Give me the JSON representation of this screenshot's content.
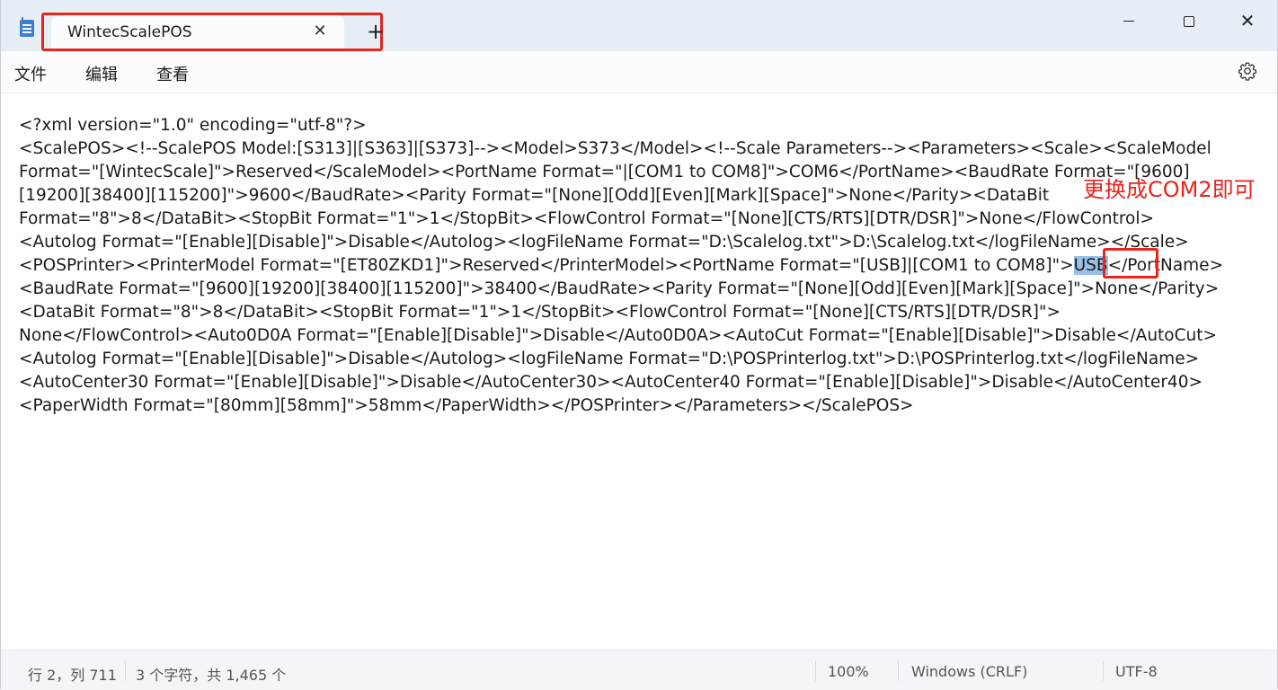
{
  "tab": {
    "title": "WintecScalePOS",
    "close_glyph": "✕",
    "new_tab_glyph": "+"
  },
  "window_controls": {
    "close_glyph": "✕"
  },
  "menu": {
    "file": "文件",
    "edit": "编辑",
    "view": "查看"
  },
  "editor": {
    "lines": [
      "<?xml version=\"1.0\" encoding=\"utf-8\"?>",
      "<ScalePOS><!--ScalePOS Model:[S313]|[S363]|[S373]--><Model>S373</Model><!--Scale Parameters--><Parameters><Scale><ScaleModel",
      "Format=\"[WintecScale]\">Reserved</ScaleModel><PortName Format=\"|[COM1 to COM8]\">COM6</PortName><BaudRate Format=\"[9600]",
      "[19200][38400][115200]\">9600</BaudRate><Parity Format=\"[None][Odd][Even][Mark][Space]\">None</Parity><DataBit",
      "Format=\"8\">8</DataBit><StopBit Format=\"1\">1</StopBit><FlowControl Format=\"[None][CTS/RTS][DTR/DSR]\">None</FlowControl>",
      "<Autolog Format=\"[Enable][Disable]\">Disable</Autolog><logFileName Format=\"D:\\Scalelog.txt\">D:\\Scalelog.txt</logFileName></Scale>",
      "<POSPrinter><PrinterModel Format=\"[ET80ZKD1]\">Reserved</PrinterModel><PortName Format=\"[USB]|[COM1 to COM8]\">",
      "<BaudRate Format=\"[9600][19200][38400][115200]\">38400</BaudRate><Parity Format=\"[None][Odd][Even][Mark][Space]\">None</Parity>",
      "<DataBit Format=\"8\">8</DataBit><StopBit Format=\"1\">1</StopBit><FlowControl Format=\"[None][CTS/RTS][DTR/DSR]\">",
      "None</FlowControl><Auto0D0A Format=\"[Enable][Disable]\">Disable</Auto0D0A><AutoCut Format=\"[Enable][Disable]\">Disable</AutoCut>",
      "<Autolog Format=\"[Enable][Disable]\">Disable</Autolog><logFileName Format=\"D:\\POSPrinterlog.txt\">D:\\POSPrinterlog.txt</logFileName>",
      "<AutoCenter30 Format=\"[Enable][Disable]\">Disable</AutoCenter30><AutoCenter40 Format=\"[Enable][Disable]\">Disable</AutoCenter40>",
      "<PaperWidth Format=\"[80mm][58mm]\">58mm</PaperWidth></POSPrinter></Parameters></ScalePOS>"
    ],
    "selected_text": "USB",
    "line7_tail": "</PortName>"
  },
  "annotation": {
    "text": "更换成COM2即可",
    "color": "#e8241d"
  },
  "status": {
    "position": "行 2，列 711",
    "selection": "3 个字符，共 1,465 个",
    "zoom": "100%",
    "line_ending": "Windows (CRLF)",
    "encoding": "UTF-8"
  },
  "colors": {
    "titlebar": "#e8eef6",
    "selection": "#99c1e7",
    "highlight_box": "#e8241d"
  }
}
